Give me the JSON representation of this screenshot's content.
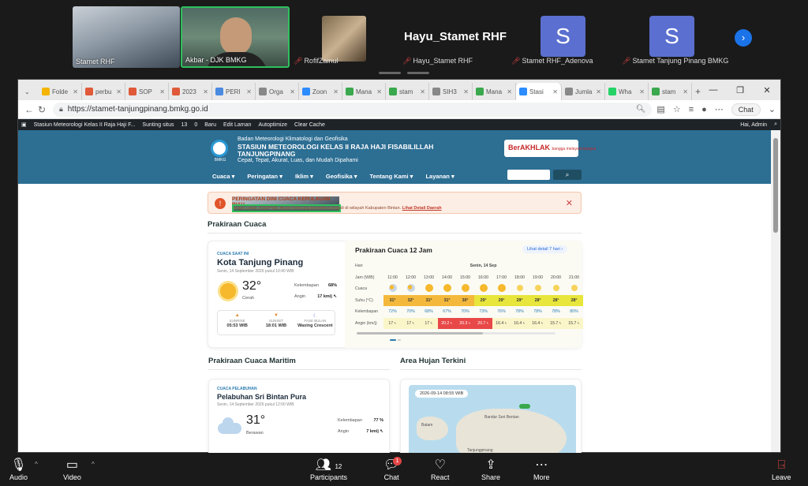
{
  "zoom": {
    "participants_strip": [
      {
        "name": "Stamet RHF"
      },
      {
        "name": "Akbar - DJK BMKG"
      },
      {
        "name": "RofifZainul",
        "muted": true
      },
      {
        "name": "Hayu_Stamet RHF",
        "muted": true,
        "big_name": "Hayu_Stamet RHF"
      },
      {
        "name": "Stamet RHF_Adenova",
        "muted": true,
        "initial": "S"
      },
      {
        "name": "Stamet Tanjung Pinang BMKG",
        "muted": true,
        "initial": "S"
      }
    ],
    "toolbar": {
      "audio": "Audio",
      "video": "Video",
      "participants": "Participants",
      "participants_count": "12",
      "chat": "Chat",
      "chat_badge": "1",
      "react": "React",
      "share": "Share",
      "more": "More",
      "leave": "Leave"
    }
  },
  "browser": {
    "tabs": [
      "Folde",
      "perbu",
      "SOP",
      "2023",
      "PERI",
      "Orga",
      "Zoon",
      "Mana",
      "stam",
      "SIH3",
      "Mana",
      "Stasi",
      "Jumla",
      "Wha",
      "stam"
    ],
    "active_tab_index": 11,
    "url": "https://stamet-tanjungpinang.bmkg.go.id",
    "chat_btn": "Chat"
  },
  "wp_bar": {
    "site": "Stasiun Meteorologi Kelas II Raja Haji F...",
    "edit_site": "Sunting situs",
    "updates": "13",
    "comments": "0",
    "new": "Baru",
    "edit_page": "Edit Laman",
    "autoptimize": "Autoptimize",
    "clear_cache": "Clear Cache",
    "greeting": "Hai, Admin"
  },
  "site": {
    "agency": "Badan Meteorologi Klimatologi dan Geofisika",
    "station_line1": "STASIUN METEOROLOGI KELAS II RAJA HAJI FISABILILLAH",
    "station_line2": "TANJUNGPINANG",
    "tagline": "Cepat, Tepat, Akurat, Luas, dan Mudah Dipahami",
    "logo_text": "BMKG",
    "berakhlak": "BerAKHLAK",
    "berakhlak_sub": "bangga melayani bangsa",
    "menu": [
      "Cuaca ▾",
      "Peringatan ▾",
      "Iklim ▾",
      "Geofisika ▾",
      "Tentang Kami ▾",
      "Layanan ▾"
    ]
  },
  "warning": {
    "title": "PERINGATAN DINI CUACA KEPULAUAN RIAU",
    "text": "Hujan Lebat, Kilat/Petir, Angin Kencang berpotensi terjadi di wilayah Kabupaten Bintan.",
    "link": "Lihat Detail Daerah"
  },
  "prakiraan": {
    "section_title": "Prakiraan Cuaca",
    "current": {
      "tag": "CUACA SAAT INI",
      "city": "Kota Tanjung Pinang",
      "date": "Senin, 14 September 2026 pukul 10:40 WIB",
      "temp": "32°",
      "cond": "Cerah",
      "hum_label": "Kelembapan",
      "hum": "68%",
      "wind_label": "Angin",
      "wind": "17 km/j ↖",
      "sunrise_label": "SUNRISE",
      "sunrise": "05:53 WIB",
      "sunset_label": "SUNSET",
      "sunset": "18:01 WIB",
      "moon_label": "FASE BULAN",
      "moon": "Waxing Crescent"
    },
    "forecast": {
      "title": "Prakiraan Cuaca 12 Jam",
      "link": "Lihat detail 7 hari ›",
      "hari_label": "Hari",
      "hari": "Senin, 14 Sep",
      "jam_label": "Jam (WIB)",
      "hours": [
        "11:00",
        "12:00",
        "13:00",
        "14:00",
        "15:00",
        "16:00",
        "17:00",
        "18:00",
        "19:00",
        "20:00",
        "21:00"
      ],
      "cuaca_label": "Cuaca",
      "suhu_label": "Suhu (°C)",
      "kel_label": "Kelembapan",
      "angin_label": "Angin (km/j)",
      "suhu": [
        "31°",
        "32°",
        "31°",
        "31°",
        "30°",
        "29°",
        "29°",
        "29°",
        "28°",
        "28°",
        "28°"
      ],
      "kelembapan": [
        "72%",
        "70%",
        "68%",
        "67%",
        "70%",
        "73%",
        "76%",
        "78%",
        "78%",
        "78%",
        "80%"
      ],
      "angin": [
        "17",
        "17",
        "17",
        "20.2",
        "20.3",
        "20.7",
        "16.4",
        "16.4",
        "16.4",
        "15.7",
        "15.7"
      ],
      "icons": [
        "partly",
        "partly",
        "sun",
        "sun",
        "sun",
        "sun",
        "sun",
        "night",
        "night",
        "night",
        "night"
      ]
    }
  },
  "maritim": {
    "section_title": "Prakiraan Cuaca Maritim",
    "tag": "CUACA PELABUHAN",
    "name": "Pelabuhan Sri Bintan Pura",
    "date": "Senin, 14 September 2026 pukul 12:00 WIB",
    "temp": "31°",
    "cond": "Berawan",
    "hum_label": "Kelembapan",
    "hum": "77 %",
    "wind_label": "Angin",
    "wind": "7 km/j ↖"
  },
  "hujan": {
    "section_title": "Area Hujan Terkini",
    "timestamp": "2026-09-14 08:55 WIB",
    "labels": [
      "Batam",
      "Bandar Seri Bentan",
      "Tanjungpinang"
    ]
  }
}
